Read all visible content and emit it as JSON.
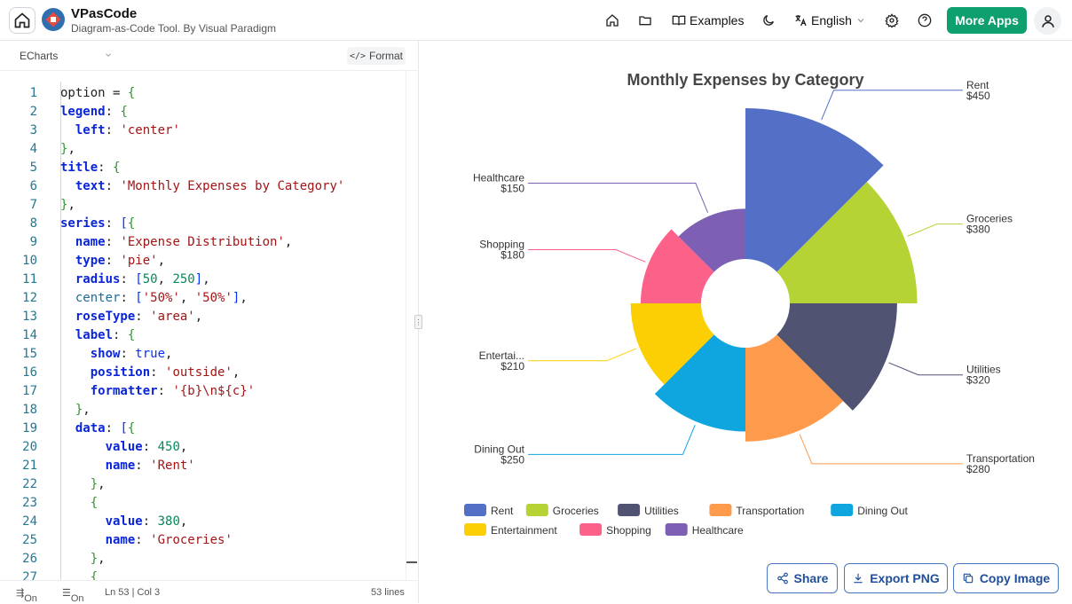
{
  "header": {
    "app_title": "VPasCode",
    "app_subtitle": "Diagram-as-Code Tool. By Visual Paradigm",
    "examples_label": "Examples",
    "language_label": "English",
    "more_apps_label": "More Apps"
  },
  "editor": {
    "language": "ECharts",
    "format_label": "Format",
    "lines": [
      {
        "n": "1",
        "t": "option = {"
      },
      {
        "n": "2",
        "t": "  legend: {"
      },
      {
        "n": "3",
        "t": "    left: 'center'"
      },
      {
        "n": "4",
        "t": "  },"
      },
      {
        "n": "5",
        "t": "  title: {"
      },
      {
        "n": "6",
        "t": "    text: 'Monthly Expenses by Category'"
      },
      {
        "n": "7",
        "t": "  },"
      },
      {
        "n": "8",
        "t": "  series: [{"
      },
      {
        "n": "9",
        "t": "    name: 'Expense Distribution',"
      },
      {
        "n": "10",
        "t": "    type: 'pie',"
      },
      {
        "n": "11",
        "t": "    radius: [50, 250],"
      },
      {
        "n": "12",
        "t": "    center: ['50%', '50%'],"
      },
      {
        "n": "13",
        "t": "    roseType: 'area',"
      },
      {
        "n": "14",
        "t": "    label: {"
      },
      {
        "n": "15",
        "t": "      show: true,"
      },
      {
        "n": "16",
        "t": "      position: 'outside',"
      },
      {
        "n": "17",
        "t": "      formatter: '{b}\\n${c}'"
      },
      {
        "n": "18",
        "t": "    },"
      },
      {
        "n": "19",
        "t": "    data: [{"
      },
      {
        "n": "20",
        "t": "        value: 450,"
      },
      {
        "n": "21",
        "t": "        name: 'Rent'"
      },
      {
        "n": "22",
        "t": "      },"
      },
      {
        "n": "23",
        "t": "      {"
      },
      {
        "n": "24",
        "t": "        value: 380,"
      },
      {
        "n": "25",
        "t": "        name: 'Groceries'"
      },
      {
        "n": "26",
        "t": "      },"
      },
      {
        "n": "27",
        "t": "      {"
      }
    ],
    "status": {
      "wrap": "On",
      "minimap": "On",
      "cursor": "Ln 53 | Col 3",
      "lines_total": "53 lines"
    }
  },
  "chart_data": {
    "type": "pie",
    "rose_type": "area",
    "title": "Monthly Expenses by Category",
    "legend_position": "bottom-center",
    "label_format": "{b}\\n${c}",
    "categories": [
      "Rent",
      "Groceries",
      "Utilities",
      "Transportation",
      "Dining Out",
      "Entertainment",
      "Shopping",
      "Healthcare"
    ],
    "values": [
      450,
      380,
      320,
      280,
      250,
      210,
      180,
      150
    ],
    "slice_labels": [
      "Rent",
      "Groceries",
      "Utilities",
      "Transportation",
      "Dining Out",
      "Entertai...",
      "Shopping",
      "Healthcare"
    ],
    "value_labels": [
      "$450",
      "$380",
      "$320",
      "$280",
      "$250",
      "$210",
      "$180",
      "$150"
    ],
    "colors": [
      "#5470c6",
      "#b5d334",
      "#505372",
      "#fd9a4c",
      "#0fa5df",
      "#fccf04",
      "#fb6189",
      "#7d5fb3"
    ]
  },
  "actions": {
    "share_label": "Share",
    "export_label": "Export PNG",
    "copy_label": "Copy Image"
  }
}
